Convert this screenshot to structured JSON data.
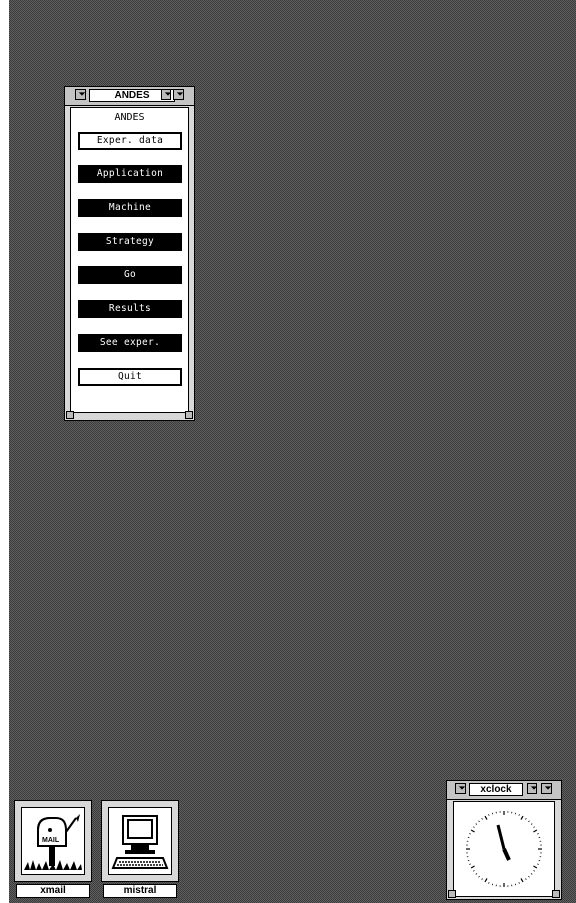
{
  "andes_window": {
    "title": "ANDES",
    "label": "ANDES",
    "buttons": {
      "exper_data": "Exper. data",
      "application": "Application",
      "machine": "Machine",
      "strategy": "Strategy",
      "go": "Go",
      "results": "Results",
      "see_exper": "See exper.",
      "quit": "Quit"
    }
  },
  "icons": {
    "xmail": {
      "label": "xmail",
      "icon": "mailbox-icon"
    },
    "mistral": {
      "label": "mistral",
      "icon": "computer-icon"
    }
  },
  "xclock": {
    "title": "xclock"
  },
  "colors": {
    "desktop": "#3c3c3c",
    "window_frame": "#d8d8d8",
    "button_dark": "#000000",
    "button_text_dark": "#ffffff"
  }
}
